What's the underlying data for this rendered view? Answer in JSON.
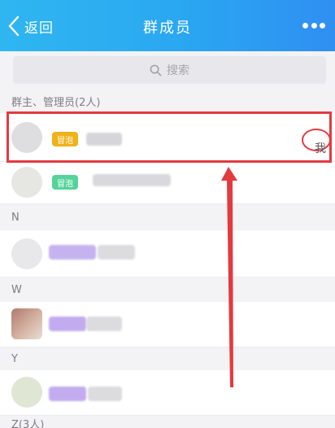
{
  "nav": {
    "back_label": "返回",
    "title": "群成员"
  },
  "search": {
    "placeholder": "搜索"
  },
  "sections": {
    "admins_header": "群主、管理员(2人)",
    "n_header": "N",
    "w_header": "W",
    "y_header": "Y",
    "z_header": "Z(3人)"
  },
  "members": {
    "admin1_badge": "冒泡",
    "admin1_me": "我",
    "admin2_badge": "冒泡"
  },
  "colors": {
    "navbar_start": "#2fb6f1",
    "navbar_end": "#2f8ff2",
    "badge_yellow": "#f0b21a",
    "badge_green": "#54d39b",
    "highlight": "#e33a3f"
  }
}
